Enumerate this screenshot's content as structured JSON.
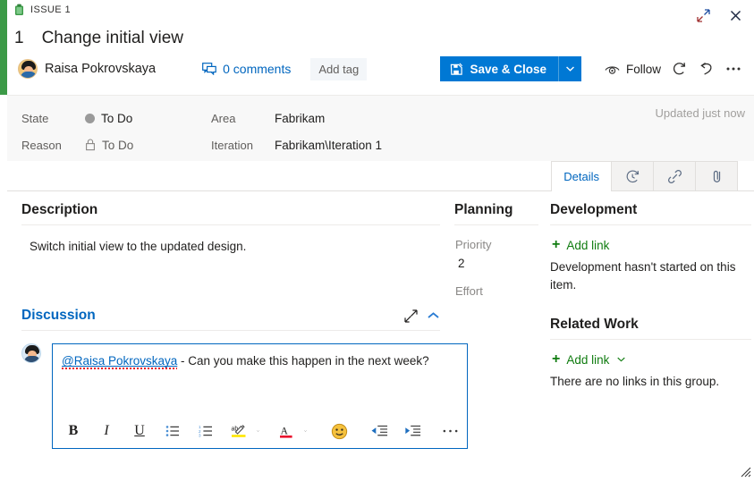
{
  "window": {
    "expand_icon": "expand-diagonal-icon",
    "close_icon": "close-icon",
    "resize_grip_icon": "resize-grip-icon"
  },
  "header": {
    "issue_type_icon": "issue-green-icon",
    "issue_type_label": "ISSUE 1",
    "work_item_id": "1",
    "title": "Change initial view",
    "assigned_to": "Raisa Pokrovskaya",
    "comments_label": "0 comments",
    "comments_icon": "comment-bubble-icon",
    "add_tag_label": "Add tag",
    "save_close_label": "Save & Close",
    "save_close_icon": "save-disk-icon",
    "save_close_caret_icon": "chevron-down-icon",
    "follow_label": "Follow",
    "follow_icon": "eye-icon",
    "refresh_icon": "refresh-icon",
    "undo_icon": "undo-icon",
    "more_icon": "ellipsis-icon",
    "accent_color": "#3c9a47",
    "primary_color": "#0078d4"
  },
  "fields": {
    "state_label": "State",
    "state_value": "To Do",
    "state_dot_color": "#9a9a9a",
    "reason_label": "Reason",
    "reason_value": "To Do",
    "reason_icon": "lock-icon",
    "area_label": "Area",
    "area_value": "Fabrikam",
    "iteration_label": "Iteration",
    "iteration_value": "Fabrikam\\Iteration 1",
    "updated_status": "Updated just now"
  },
  "tabs": [
    {
      "label": "Details",
      "icon": "",
      "active": true,
      "name": "tab-details"
    },
    {
      "label": "",
      "icon": "history-clock-icon",
      "active": false,
      "name": "tab-history"
    },
    {
      "label": "",
      "icon": "link-chain-icon",
      "active": false,
      "name": "tab-links"
    },
    {
      "label": "",
      "icon": "paperclip-icon",
      "active": false,
      "name": "tab-attachments"
    }
  ],
  "description": {
    "heading": "Description",
    "text": "Switch initial view to the updated design."
  },
  "discussion": {
    "heading": "Discussion",
    "expand_icon": "expand-diagonal-icon",
    "collapse_icon": "chevron-up-icon",
    "comment_mention": "@Raisa Pokrovskaya",
    "comment_rest": " - Can you make this happen in the next week?",
    "toolbar": [
      {
        "name": "bold-button",
        "glyph": "B",
        "label": "Bold"
      },
      {
        "name": "italic-button",
        "glyph": "I",
        "label": "Italic"
      },
      {
        "name": "underline-button",
        "glyph": "U",
        "label": "Underline"
      },
      {
        "name": "bulleted-list-button",
        "glyph": "bullet-list-icon",
        "label": "Bulleted list"
      },
      {
        "name": "numbered-list-button",
        "glyph": "numbered-list-icon",
        "label": "Numbered list"
      },
      {
        "name": "highlight-color-button",
        "glyph": "highlighter-icon",
        "label": "Highlight"
      },
      {
        "name": "font-color-button",
        "glyph": "font-color-icon",
        "label": "Font color"
      },
      {
        "name": "emoji-button",
        "glyph": "emoji-icon",
        "label": "Emoji"
      },
      {
        "name": "decrease-indent-button",
        "glyph": "decrease-indent-icon",
        "label": "Decrease indent"
      },
      {
        "name": "increase-indent-button",
        "glyph": "increase-indent-icon",
        "label": "Increase indent"
      },
      {
        "name": "more-formatting-button",
        "glyph": "ellipsis-icon",
        "label": "More"
      }
    ]
  },
  "planning": {
    "heading": "Planning",
    "priority_label": "Priority",
    "priority_value": "2",
    "effort_label": "Effort",
    "effort_value": ""
  },
  "development": {
    "heading": "Development",
    "add_link_label": "Add link",
    "empty_note": "Development hasn't started on this item."
  },
  "related_work": {
    "heading": "Related Work",
    "add_link_label": "Add link",
    "add_link_caret_icon": "chevron-down-icon",
    "empty_note": "There are no links in this group."
  }
}
